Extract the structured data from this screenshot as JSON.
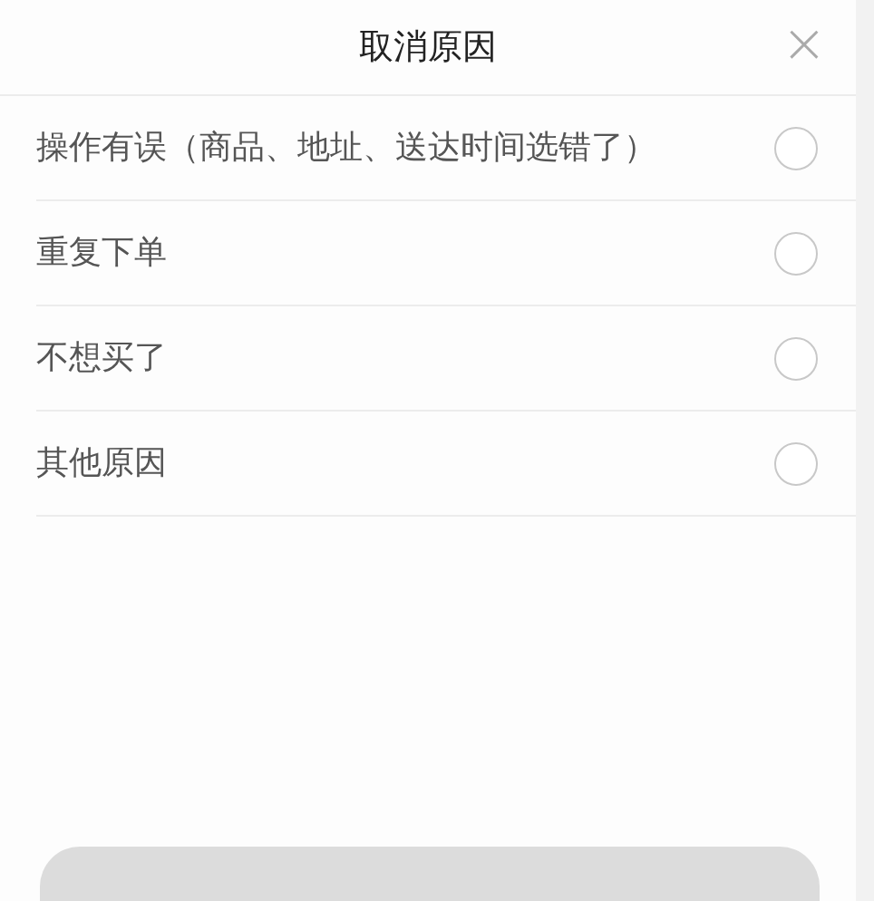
{
  "title": "取消原因",
  "close": "×",
  "reasons": [
    {
      "label": "操作有误（商品、地址、送达时间选错了）",
      "selected": false
    },
    {
      "label": "重复下单",
      "selected": false
    },
    {
      "label": "不想买了",
      "selected": false
    },
    {
      "label": "其他原因",
      "selected": false
    }
  ]
}
